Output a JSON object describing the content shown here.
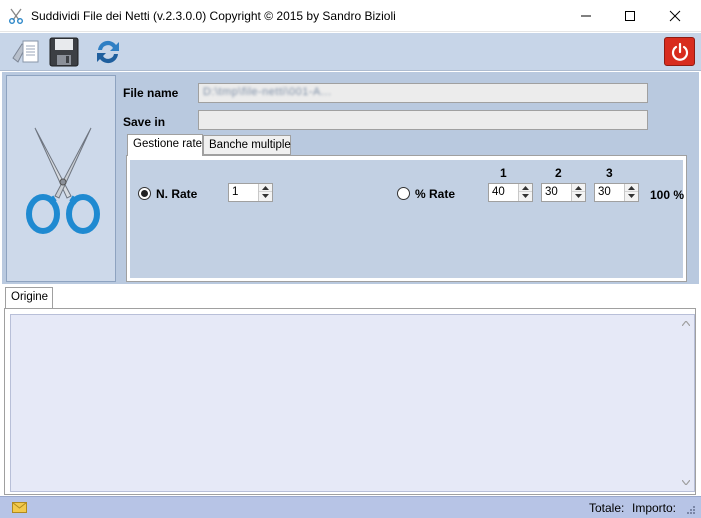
{
  "window": {
    "title": "Suddividi File dei Netti  (v.2.3.0.0) Copyright © 2015 by Sandro Bizioli"
  },
  "toolbar": {
    "icons": [
      "open-document-icon",
      "save-icon",
      "refresh-icon"
    ],
    "power_icon": "power-icon",
    "power_color": "#d82c1e"
  },
  "form": {
    "file_name_label": "File name",
    "file_name_value": "D:\\tmp\\file-netti\\001-A...",
    "save_in_label": "Save in",
    "save_in_value": ""
  },
  "tabs": {
    "items": [
      {
        "label": "Gestione rate",
        "active": true
      },
      {
        "label": "Banche multiple",
        "active": false
      }
    ]
  },
  "rate": {
    "n_rate_label": "N. Rate",
    "n_rate_selected": true,
    "n_rate_value": "1",
    "pct_rate_label": "% Rate",
    "pct_rate_selected": false,
    "columns": [
      "1",
      "2",
      "3"
    ],
    "pct_values": [
      "40",
      "30",
      "30"
    ],
    "total_pct": "100 %"
  },
  "origin": {
    "tab_label": "Origine"
  },
  "status": {
    "totale_label": "Totale:",
    "importo_label": "Importo:"
  },
  "colors": {
    "toolbar_bg": "#c7d5e8",
    "panel_bg": "#b9c9df",
    "text_area_bg": "#e6e9f7",
    "statusbar_bg": "#b7c4e6"
  }
}
